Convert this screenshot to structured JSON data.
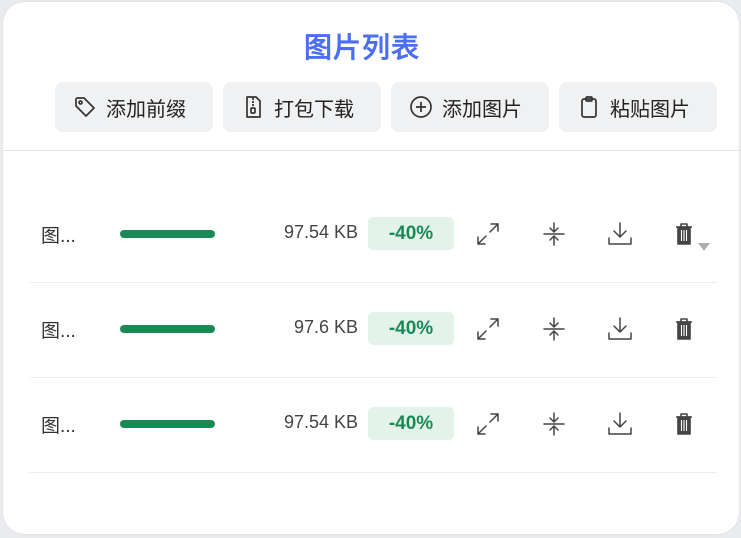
{
  "title": "图片列表",
  "toolbar": {
    "add_prefix": "添加前缀",
    "pack_download": "打包下载",
    "add_image": "添加图片",
    "paste_image": "粘贴图片"
  },
  "rows": [
    {
      "name": "图...",
      "size": "97.54 KB",
      "saving": "-40%",
      "progress": 1.0
    },
    {
      "name": "图...",
      "size": "97.6 KB",
      "saving": "-40%",
      "progress": 1.0
    },
    {
      "name": "图...",
      "size": "97.54 KB",
      "saving": "-40%",
      "progress": 1.0
    }
  ],
  "colors": {
    "accent": "#4b6ef5",
    "success": "#1a8a55",
    "success_bg": "#e3f3ea",
    "button_bg": "#f0f1f2"
  },
  "icons": {
    "add_prefix": "tag-icon",
    "pack_download": "zip-file-icon",
    "add_image": "plus-circle-icon",
    "paste_image": "clipboard-icon",
    "row_actions": [
      "expand-icon",
      "compress-icon",
      "download-icon",
      "trash-icon"
    ]
  }
}
